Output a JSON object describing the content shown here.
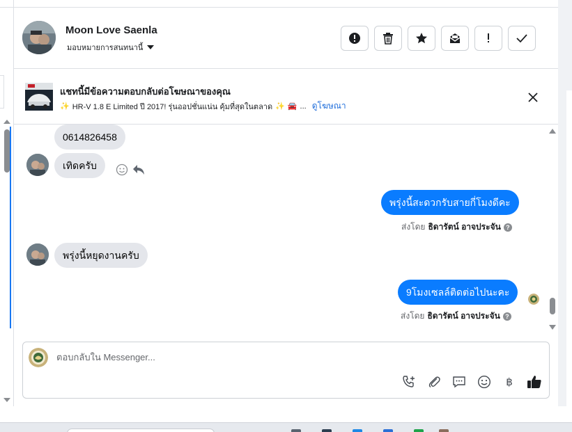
{
  "header": {
    "contact_name": "Moon Love Saenla",
    "assign_label": "มอบหมายการสนทนานี้",
    "actions": [
      {
        "icon": "alert-circle-icon",
        "label": "spam"
      },
      {
        "icon": "trash-icon",
        "label": "delete"
      },
      {
        "icon": "star-icon",
        "label": "follow-up"
      },
      {
        "icon": "mark-unread-icon",
        "label": "mark-unread"
      },
      {
        "icon": "exclamation-icon",
        "label": "priority"
      },
      {
        "icon": "check-icon",
        "label": "done"
      }
    ]
  },
  "ad_banner": {
    "title": "แชทนี้มีข้อความตอบกลับต่อโฆษณาของคุณ",
    "subtitle": "HR-V 1.8 E Limited ปี 2017! รุ่นออปชั่นแน่น คุ้มที่สุดในตลาด",
    "ellipsis": "...",
    "link": "ดูโฆษณา"
  },
  "messages": {
    "phone": "0614826458",
    "reply1": "เทิดครับ",
    "out1": "พรุ่งนี้สะดวกรับสายกี่โมงดีคะ",
    "sent_by_label": "ส่งโดย",
    "agent_name": "ธิดารัตน์ อาจประจัน",
    "help_mark": "?",
    "reply2": "พรุ่งนี้หยุดงานครับ",
    "out2": "9โมงเซลล์ติดต่อไปนะคะ"
  },
  "composer": {
    "placeholder": "ตอบกลับใน Messenger...",
    "baht_symbol": "฿"
  },
  "colors": {
    "outgoing_bubble": "#0a7cff",
    "incoming_bubble": "#e4e6eb",
    "link": "#216fdb"
  }
}
